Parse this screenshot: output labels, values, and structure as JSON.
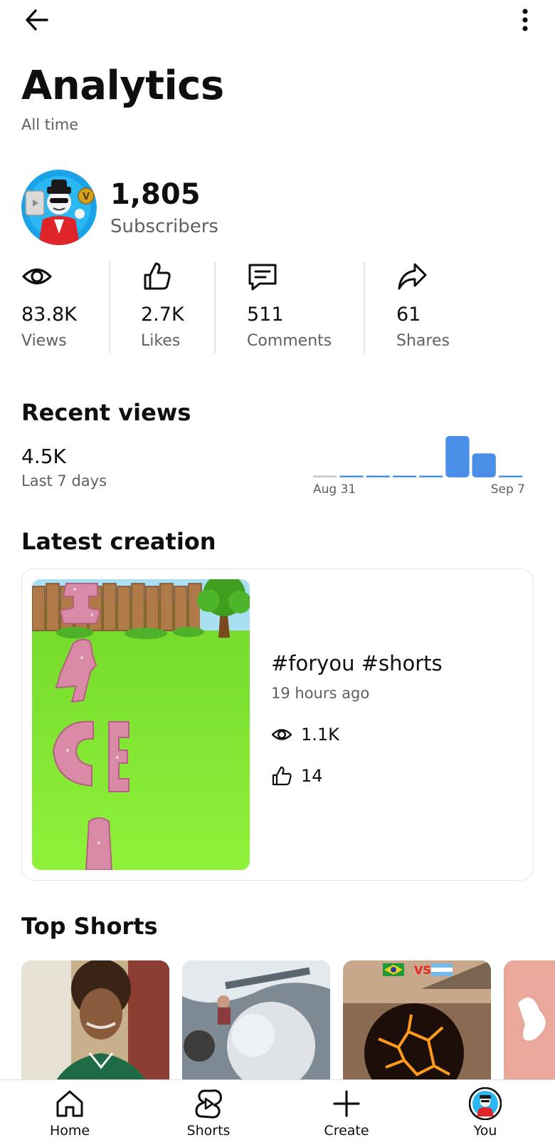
{
  "header": {
    "title": "Analytics",
    "subtitle": "All time"
  },
  "channel": {
    "subscribers_value": "1,805",
    "subscribers_label": "Subscribers"
  },
  "stats": [
    {
      "value": "83.8K",
      "label": "Views",
      "icon": "eye-icon"
    },
    {
      "value": "2.7K",
      "label": "Likes",
      "icon": "thumbs-up-icon"
    },
    {
      "value": "511",
      "label": "Comments",
      "icon": "comment-icon"
    },
    {
      "value": "61",
      "label": "Shares",
      "icon": "share-icon"
    }
  ],
  "recent_views": {
    "title": "Recent views",
    "value": "4.5K",
    "period": "Last 7 days",
    "chart_data": {
      "type": "bar",
      "categories": [
        "",
        "",
        "",
        "",
        "",
        "",
        "",
        ""
      ],
      "values": [
        0,
        0,
        0,
        0,
        0,
        1.0,
        0.58,
        0.04
      ],
      "x_start_label": "Aug 31",
      "x_end_label": "Sep 7",
      "colors": {
        "bar": "#4a8fe7",
        "baseline": "#c8c8c8"
      }
    }
  },
  "latest_creation": {
    "title": "Latest creation",
    "video_title": "#foryou #shorts",
    "time_ago": "19 hours ago",
    "views": "1.1K",
    "likes": "14"
  },
  "top_shorts": {
    "title": "Top Shorts"
  },
  "bottom_nav": [
    {
      "label": "Home",
      "icon": "home-icon"
    },
    {
      "label": "Shorts",
      "icon": "shorts-icon"
    },
    {
      "label": "Create",
      "icon": "plus-icon"
    },
    {
      "label": "You",
      "icon": "avatar-icon"
    }
  ],
  "colors": {
    "accent_blue": "#4a8fe7",
    "text_primary": "#0f0f0f",
    "text_secondary": "#606060"
  }
}
